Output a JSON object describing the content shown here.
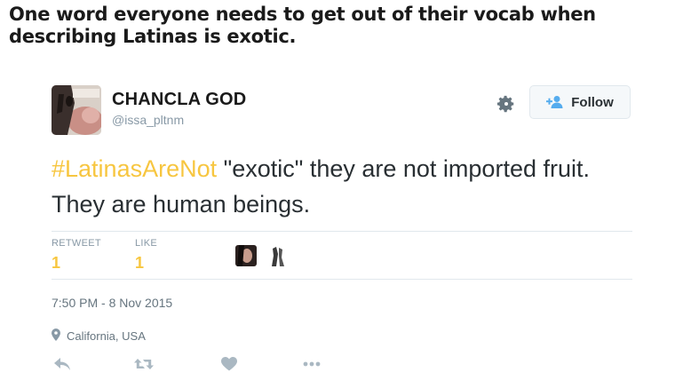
{
  "headline": "One word everyone needs to get out of their vocab when describing Latinas is exotic.",
  "tweet": {
    "display_name": "CHANCLA GOD",
    "handle": "@issa_pltnm",
    "follow_label": "Follow",
    "hashtag": "#LatinasAreNot",
    "text_rest": " \"exotic\" they are not imported fruit. They are human beings.",
    "retweet_label": "RETWEET",
    "retweet_count": "1",
    "like_label": "LIKE",
    "like_count": "1",
    "timestamp": "7:50 PM - 8 Nov 2015",
    "location": "California, USA"
  },
  "icons": {
    "settings": "gear-icon",
    "follow": "add-person-icon",
    "location": "map-pin-icon",
    "reply": "reply-icon",
    "retweet": "retweet-icon",
    "like": "heart-icon",
    "more": "more-dots-icon"
  },
  "colors": {
    "hashtag": "#f7c640",
    "count": "#f7c640",
    "follow_icon": "#55acee",
    "muted": "#8899a6",
    "action_icon": "#aab8c2"
  }
}
